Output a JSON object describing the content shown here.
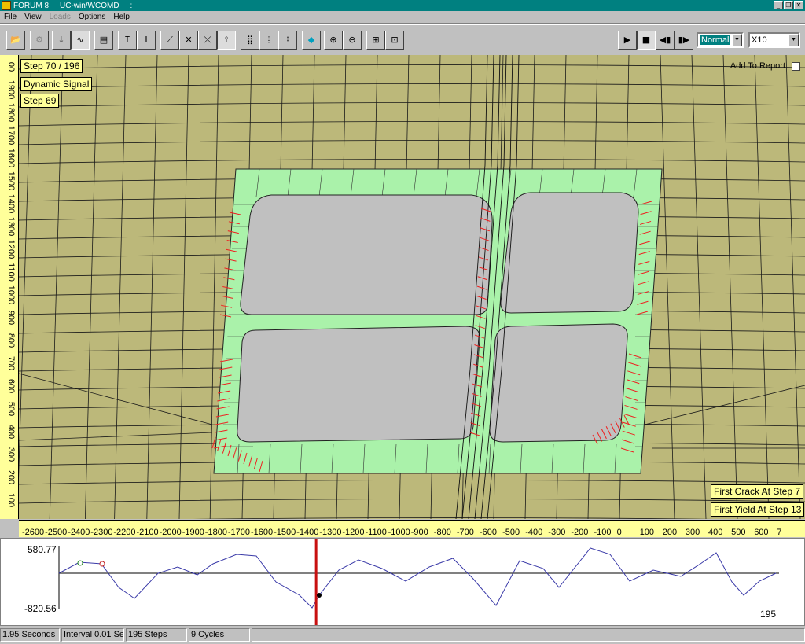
{
  "window": {
    "app_name": "FORUM 8",
    "title": "UC-win/WCOMD",
    "title_suffix": ":"
  },
  "menu": {
    "file": "File",
    "view": "View",
    "loads": "Loads",
    "options": "Options",
    "help": "Help"
  },
  "toolbar": {
    "speed_mode": "Normal",
    "zoom_factor": "X10"
  },
  "overlay": {
    "step_label": "Step 70 / 196",
    "signal_label": "Dynamic Signal",
    "step_current": "Step 69",
    "add_to_report": "Add To Report",
    "first_crack": "First Crack At Step 7",
    "first_yield": "First Yield At Step 13"
  },
  "ruler": {
    "vertical": [
      "100",
      "200",
      "300",
      "400",
      "500",
      "600",
      "700",
      "800",
      "900",
      "1000",
      "1100",
      "1200",
      "1300",
      "1400",
      "1500",
      "1600",
      "1700",
      "1800",
      "1900",
      "00"
    ],
    "horizontal": [
      "-2600",
      "-2500",
      "-2400",
      "-2300",
      "-2200",
      "-2100",
      "-2000",
      "-1900",
      "-1800",
      "-1700",
      "-1600",
      "-1500",
      "-1400",
      "-1300",
      "-1200",
      "-1100",
      "-1000",
      "-900",
      "-800",
      "-700",
      "-600",
      "-500",
      "-400",
      "-300",
      "-200",
      "-100",
      "0",
      "100",
      "200",
      "300",
      "400",
      "500",
      "600",
      "7"
    ]
  },
  "signal": {
    "y_max": "580.77",
    "y_min": "-820.56",
    "end_step": "195",
    "cursor_step": 70,
    "total_steps": 196
  },
  "status": {
    "duration": "1.95 Seconds",
    "interval": "Interval 0.01 Se",
    "steps": "195 Steps",
    "cycles": "9 Cycles"
  },
  "colors": {
    "background": "#bcb87a",
    "ruler": "#ffff9a",
    "concrete": "#aaf2aa",
    "opening": "#c0c0c0",
    "crack": "#ee2020",
    "signal": "#3a3aa8",
    "cursor": "#c81010"
  }
}
